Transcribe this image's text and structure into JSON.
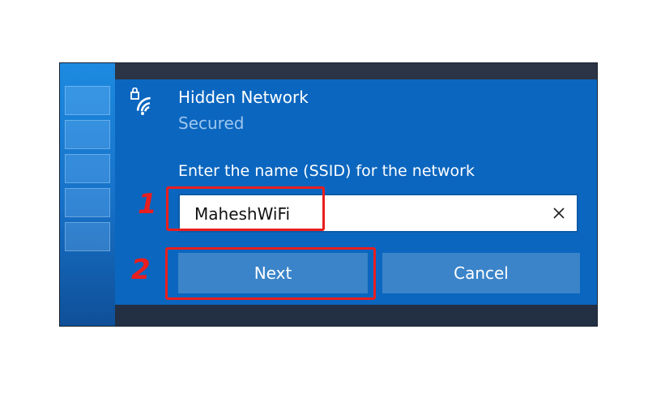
{
  "network": {
    "name": "Hidden Network",
    "status": "Secured",
    "icon": "wifi-secured-icon"
  },
  "ssid_prompt": "Enter the name (SSID) for the network",
  "ssid_input": {
    "value": "MaheshWiFi"
  },
  "buttons": {
    "next": "Next",
    "cancel": "Cancel"
  },
  "annotations": {
    "step1": "1",
    "step2": "2"
  },
  "colors": {
    "panel": "#0b66bf",
    "button": "#3b84c9",
    "highlight": "#ea1e1e",
    "subtitle": "#9cc6ee"
  }
}
